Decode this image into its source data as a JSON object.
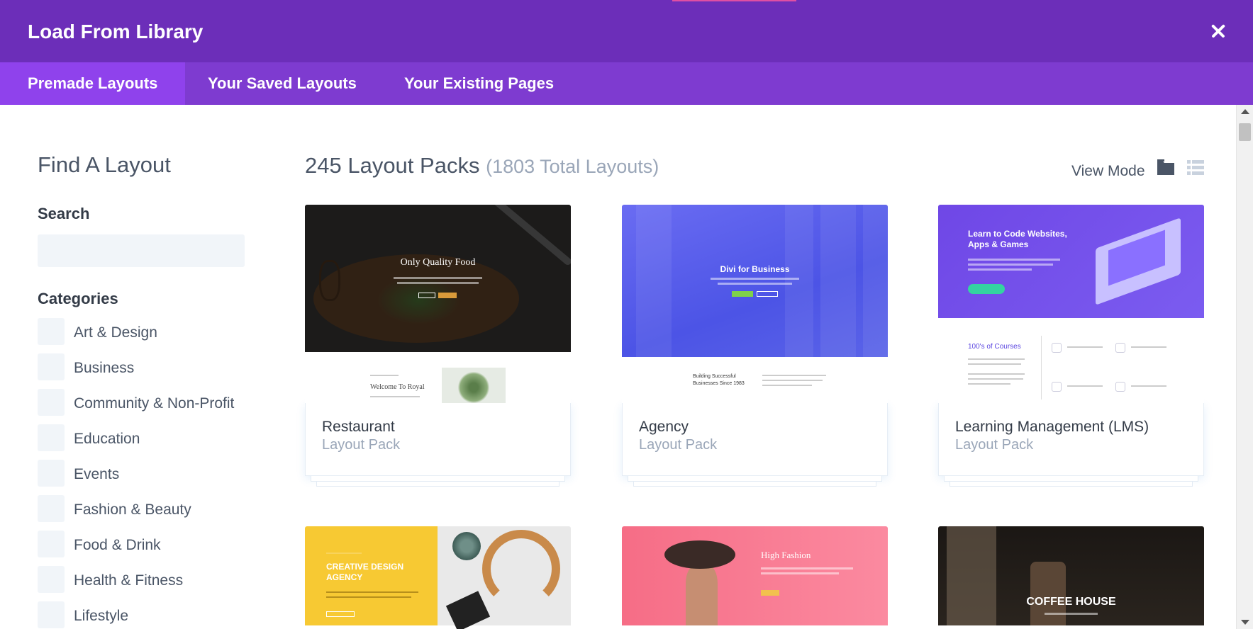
{
  "window": {
    "title": "Load From Library",
    "close_icon": "close-icon"
  },
  "tabs": [
    {
      "label": "Premade Layouts",
      "active": true
    },
    {
      "label": "Your Saved Layouts",
      "active": false
    },
    {
      "label": "Your Existing Pages",
      "active": false
    }
  ],
  "sidebar": {
    "title": "Find A Layout",
    "search_label": "Search",
    "search_placeholder": "",
    "categories_label": "Categories",
    "categories": [
      "Art & Design",
      "Business",
      "Community & Non-Profit",
      "Education",
      "Events",
      "Fashion & Beauty",
      "Food & Drink",
      "Health & Fitness",
      "Lifestyle"
    ]
  },
  "main": {
    "packs_count": "245 Layout Packs",
    "total_layouts": "(1803 Total Layouts)",
    "view_mode_label": "View Mode",
    "view_icons": [
      "grid-view-icon",
      "list-view-icon"
    ],
    "cards": [
      {
        "name": "Restaurant",
        "sub": "Layout Pack",
        "thumb_title": "Only Quality Food",
        "thumb_sub": "Welcome To Royal"
      },
      {
        "name": "Agency",
        "sub": "Layout Pack",
        "thumb_title": "Divi for Business",
        "thumb_sub": "Building Successful Businesses Since 1983"
      },
      {
        "name": "Learning Management (LMS)",
        "sub": "Layout Pack",
        "thumb_title": "Learn to Code Websites, Apps & Games",
        "thumb_sub": "100's of Courses"
      },
      {
        "name": "",
        "sub": "",
        "thumb_title": "CREATIVE DESIGN AGENCY",
        "thumb_sub": ""
      },
      {
        "name": "",
        "sub": "",
        "thumb_title": "High Fashion",
        "thumb_sub": ""
      },
      {
        "name": "",
        "sub": "",
        "thumb_title": "COFFEE HOUSE",
        "thumb_sub": ""
      }
    ]
  },
  "colors": {
    "titlebar": "#6c2eb9",
    "tabbar": "#7e3bd0",
    "active_tab": "#8f42ec",
    "accent": "#e04fa3"
  }
}
